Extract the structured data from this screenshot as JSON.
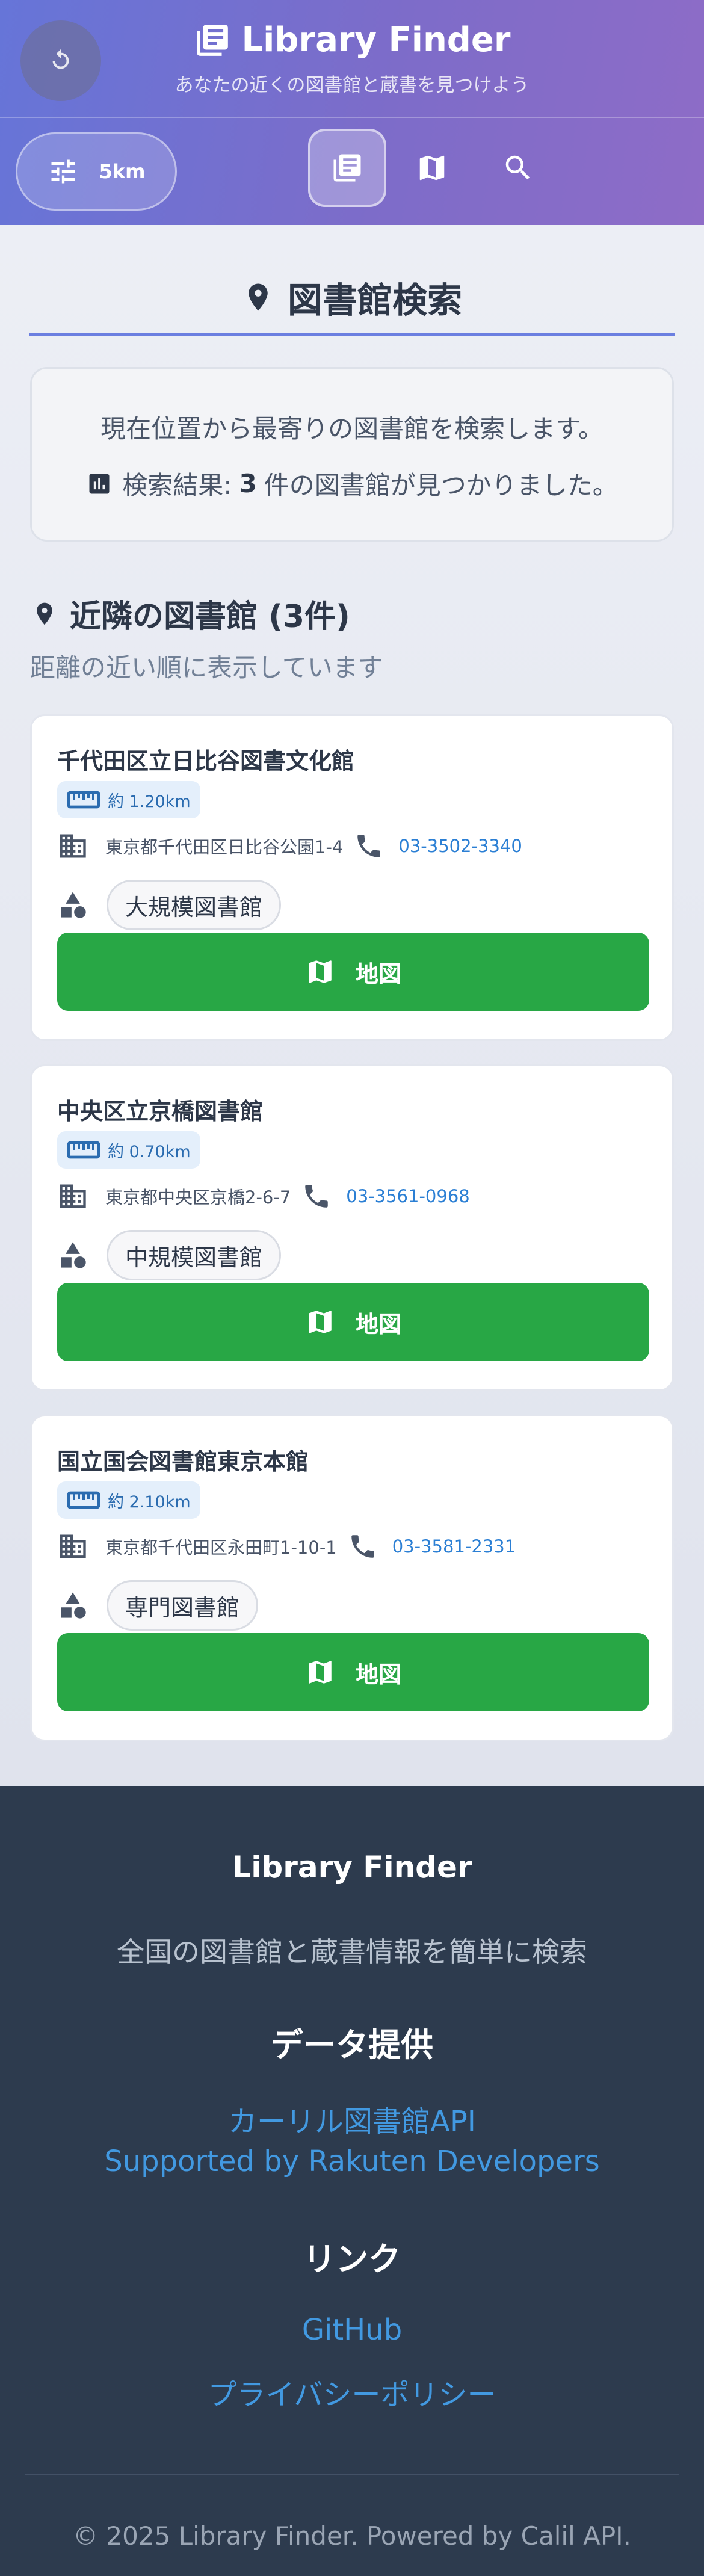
{
  "header": {
    "title": "Library Finder",
    "subtitle": "あなたの近くの図書館と蔵書を見つけよう",
    "radius": "5km",
    "icons": [
      "refresh-icon",
      "tune-icon",
      "library-icon",
      "map-icon",
      "search-icon"
    ]
  },
  "search": {
    "title": "図書館検索",
    "info_text": "現在位置から最寄りの図書館を検索します。",
    "result_prefix": "検索結果:",
    "result_count": "3",
    "result_suffix": "件の図書館が見つかりました。"
  },
  "list": {
    "title": "近隣の図書館 (3件)",
    "subtitle": "距離の近い順に表示しています"
  },
  "libraries": [
    {
      "name": "千代田区立日比谷図書文化館",
      "distance": "約 1.20km",
      "address": "東京都千代田区日比谷公園1-4",
      "phone": "03-3502-3340",
      "type": "大規模図書館",
      "map_label": "地図"
    },
    {
      "name": "中央区立京橋図書館",
      "distance": "約 0.70km",
      "address": "東京都中央区京橋2-6-7",
      "phone": "03-3561-0968",
      "type": "中規模図書館",
      "map_label": "地図"
    },
    {
      "name": "国立国会図書館東京本館",
      "distance": "約 2.10km",
      "address": "東京都千代田区永田町1-10-1",
      "phone": "03-3581-2331",
      "type": "専門図書館",
      "map_label": "地図"
    }
  ],
  "footer": {
    "brand": "Library Finder",
    "tagline": "全国の図書館と蔵書情報を簡単に検索",
    "data_heading": "データ提供",
    "data_links": [
      "カーリル図書館API",
      "Supported by Rakuten Developers"
    ],
    "links_heading": "リンク",
    "links": [
      "GitHub",
      "プライバシーポリシー"
    ],
    "copyright": "© 2025 Library Finder. Powered by Calil API."
  },
  "colors": {
    "header_gradient_start": "#6675d8",
    "header_gradient_end": "#8e6cc7",
    "accent": "#6b7fe0",
    "map_button": "#28a745",
    "link": "#4299e1",
    "footer_bg": "#2d3b4e"
  }
}
